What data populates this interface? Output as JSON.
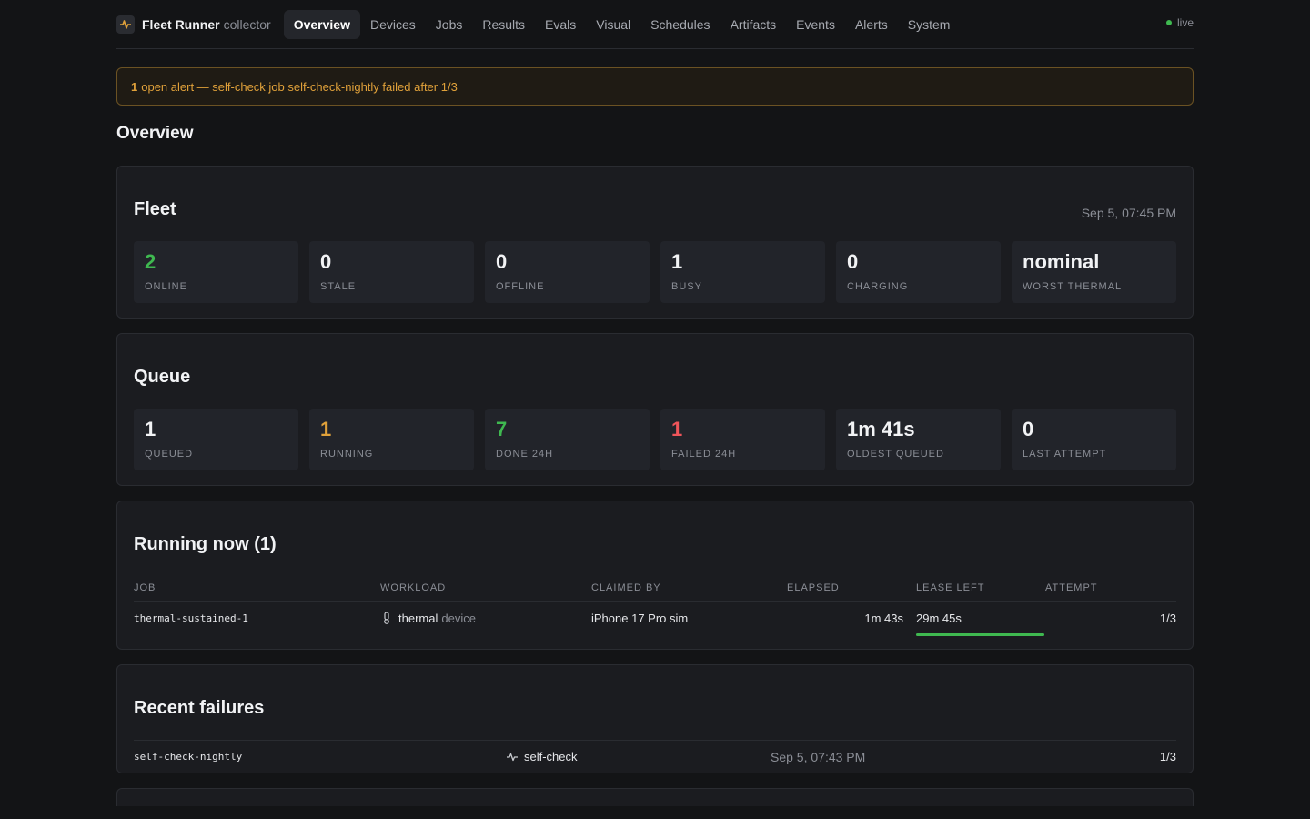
{
  "header": {
    "brand_name": "Fleet Runner",
    "brand_sub": "collector",
    "nav": [
      "Overview",
      "Devices",
      "Jobs",
      "Results",
      "Evals",
      "Visual",
      "Schedules",
      "Artifacts",
      "Events",
      "Alerts",
      "System"
    ],
    "active_nav": "Overview",
    "live_label": "live"
  },
  "alert": {
    "count": "1",
    "text": "open alert — self-check job self-check-nightly failed after 1/3"
  },
  "page_title": "Overview",
  "fleet": {
    "title": "Fleet",
    "timestamp": "Sep 5, 07:45 PM",
    "stats": [
      {
        "value": "2",
        "label": "ONLINE"
      },
      {
        "value": "0",
        "label": "STALE"
      },
      {
        "value": "0",
        "label": "OFFLINE"
      },
      {
        "value": "1",
        "label": "BUSY"
      },
      {
        "value": "0",
        "label": "CHARGING"
      },
      {
        "value": "nominal",
        "label": "WORST THERMAL"
      }
    ]
  },
  "queue": {
    "title": "Queue",
    "stats": [
      {
        "value": "1",
        "label": "QUEUED"
      },
      {
        "value": "1",
        "label": "RUNNING"
      },
      {
        "value": "7",
        "label": "DONE 24H"
      },
      {
        "value": "1",
        "label": "FAILED 24H"
      },
      {
        "value": "1m 41s",
        "label": "OLDEST QUEUED"
      },
      {
        "value": "0",
        "label": "LAST ATTEMPT"
      }
    ]
  },
  "running": {
    "title": "Running now (1)",
    "columns": [
      "JOB",
      "WORKLOAD",
      "CLAIMED BY",
      "ELAPSED",
      "LEASE LEFT",
      "ATTEMPT"
    ],
    "rows": [
      {
        "job": "thermal-sustained-1",
        "workload": "thermal",
        "workload_kind": "device",
        "workload_icon": "thermometer-icon",
        "claimed_by": "iPhone 17 Pro sim",
        "elapsed": "1m 43s",
        "lease_left": "29m 45s",
        "lease_fraction": 1.0,
        "attempt": "1/3"
      }
    ]
  },
  "failures": {
    "title": "Recent failures",
    "rows": [
      {
        "job": "self-check-nightly",
        "workload": "self-check",
        "workload_icon": "pulse-icon",
        "time": "Sep 5, 07:43 PM",
        "attempt": "1/3"
      }
    ]
  },
  "colors": {
    "accent_green": "#3fb950",
    "warning_amber": "#e0a13a",
    "error_red": "#f0555a"
  }
}
